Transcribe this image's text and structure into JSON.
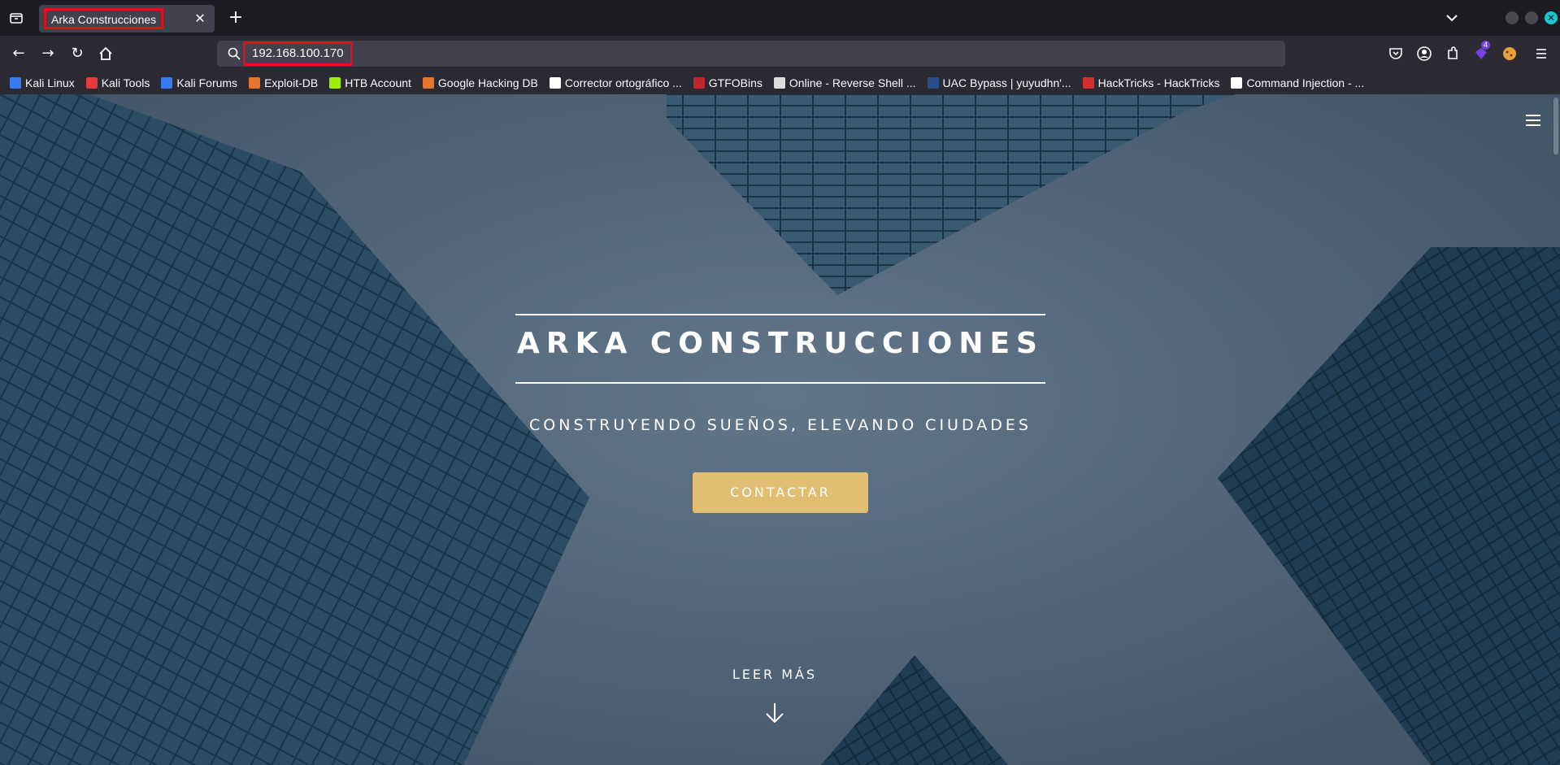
{
  "browser": {
    "tab": {
      "title": "Arka Construcciones"
    },
    "url": "192.168.100.170",
    "extension_badge": "4",
    "bookmarks": [
      {
        "label": "Kali Linux",
        "icon": "kali-icon",
        "color": "#367bf0"
      },
      {
        "label": "Kali Tools",
        "icon": "kali-tools-icon",
        "color": "#e23c3c"
      },
      {
        "label": "Kali Forums",
        "icon": "kali-forums-icon",
        "color": "#367bf0"
      },
      {
        "label": "Exploit-DB",
        "icon": "exploit-db-icon",
        "color": "#e8732a"
      },
      {
        "label": "HTB Account",
        "icon": "htb-icon",
        "color": "#9fef00"
      },
      {
        "label": "Google Hacking DB",
        "icon": "ghdb-icon",
        "color": "#e8732a"
      },
      {
        "label": "Corrector ortográfico ...",
        "icon": "corrector-icon",
        "color": "#ffffff"
      },
      {
        "label": "GTFOBins",
        "icon": "gtfobins-icon",
        "color": "#c0262d"
      },
      {
        "label": "Online - Reverse Shell ...",
        "icon": "skull-icon",
        "color": "#dddddd"
      },
      {
        "label": "UAC Bypass | yuyudhn'...",
        "icon": "uac-icon",
        "color": "#2a4f8a"
      },
      {
        "label": "HackTricks - HackTricks",
        "icon": "hacktricks-icon",
        "color": "#d32f2f"
      },
      {
        "label": "Command Injection - ...",
        "icon": "command-injection-icon",
        "color": "#ffffff"
      }
    ]
  },
  "page": {
    "title": "ARKA CONSTRUCCIONES",
    "subtitle": "CONSTRUYENDO SUEÑOS, ELEVANDO CIUDADES",
    "cta_label": "CONTACTAR",
    "read_more_label": "LEER MÁS",
    "accent_color": "#e2be72"
  }
}
